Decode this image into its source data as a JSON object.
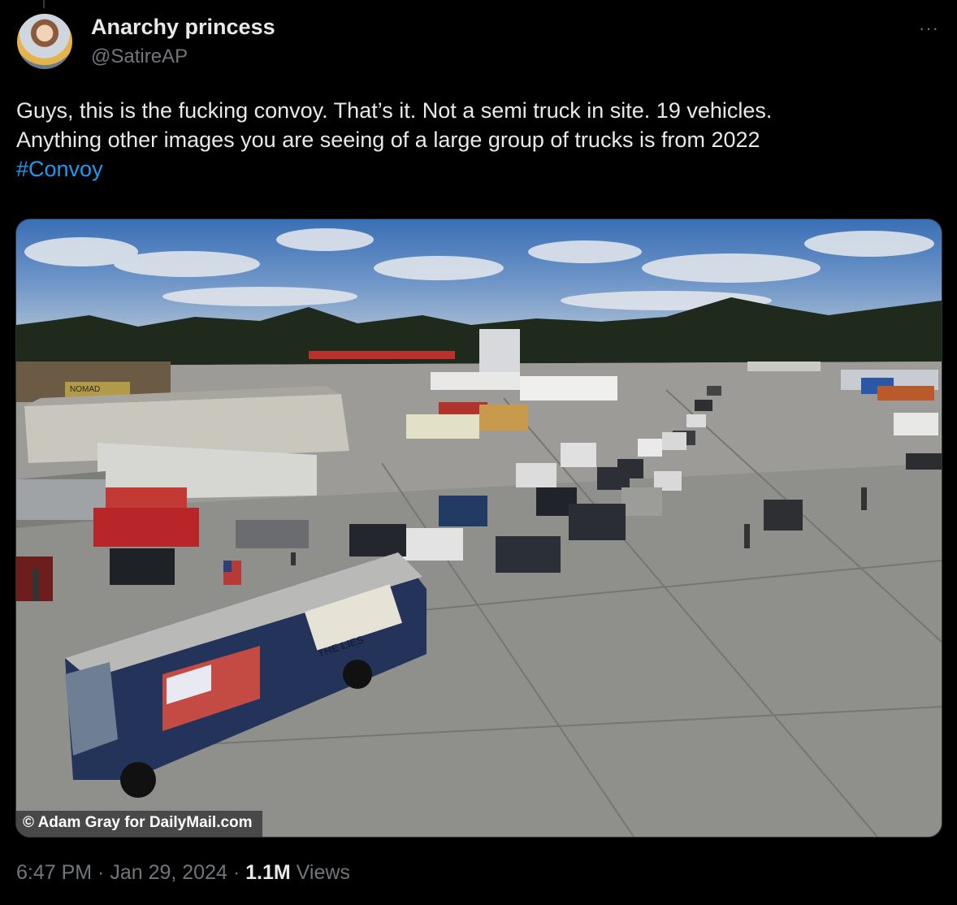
{
  "author": {
    "display_name": "Anarchy princess",
    "handle": "@SatireAP",
    "avatar_icon": "profile-avatar"
  },
  "more_icon": "ellipsis-icon",
  "more_glyph": "···",
  "tweet": {
    "line1": "Guys, this is the fucking convoy. That’s it. Not a semi truck in site. 19 vehicles.",
    "line2": "Anything other images you are seeing of a large group of trucks is from 2022",
    "hashtag": "#Convoy"
  },
  "media": {
    "credit": "© Adam Gray for DailyMail.com",
    "bus_sign_text": "THE LIES",
    "store_sign_text": "NOMAD"
  },
  "meta": {
    "time": "6:47 PM",
    "separator": " · ",
    "date": "Jan 29, 2024",
    "separator2": " · ",
    "views_count": "1.1M",
    "views_label": " Views"
  },
  "colors": {
    "background": "#000000",
    "text": "#e7e9ea",
    "secondary": "#71767b",
    "link": "#1d9bf0"
  }
}
